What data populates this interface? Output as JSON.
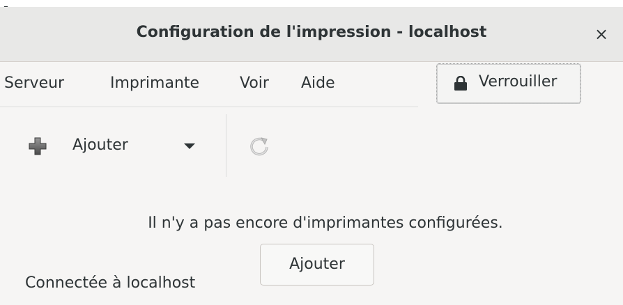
{
  "window": {
    "title": "Configuration de l'impression - localhost",
    "close_glyph": "×"
  },
  "menu": {
    "items": [
      {
        "label": "Serveur"
      },
      {
        "label": "Imprimante"
      },
      {
        "label": "Voir"
      },
      {
        "label": "Aide"
      }
    ]
  },
  "lock": {
    "label": "Verrouiller",
    "icon": "lock-icon"
  },
  "toolbar": {
    "add_label": "Ajouter",
    "add_icon": "plus-icon",
    "refresh_icon": "refresh-icon"
  },
  "main": {
    "empty_message": "Il n'y a pas encore d'imprimantes configurées.",
    "add_button_label": "Ajouter"
  },
  "status": {
    "text": "Connectée à localhost"
  },
  "colors": {
    "text": "#2e3436",
    "titlebar": "#e8e8e7",
    "background": "#f6f5f4"
  }
}
